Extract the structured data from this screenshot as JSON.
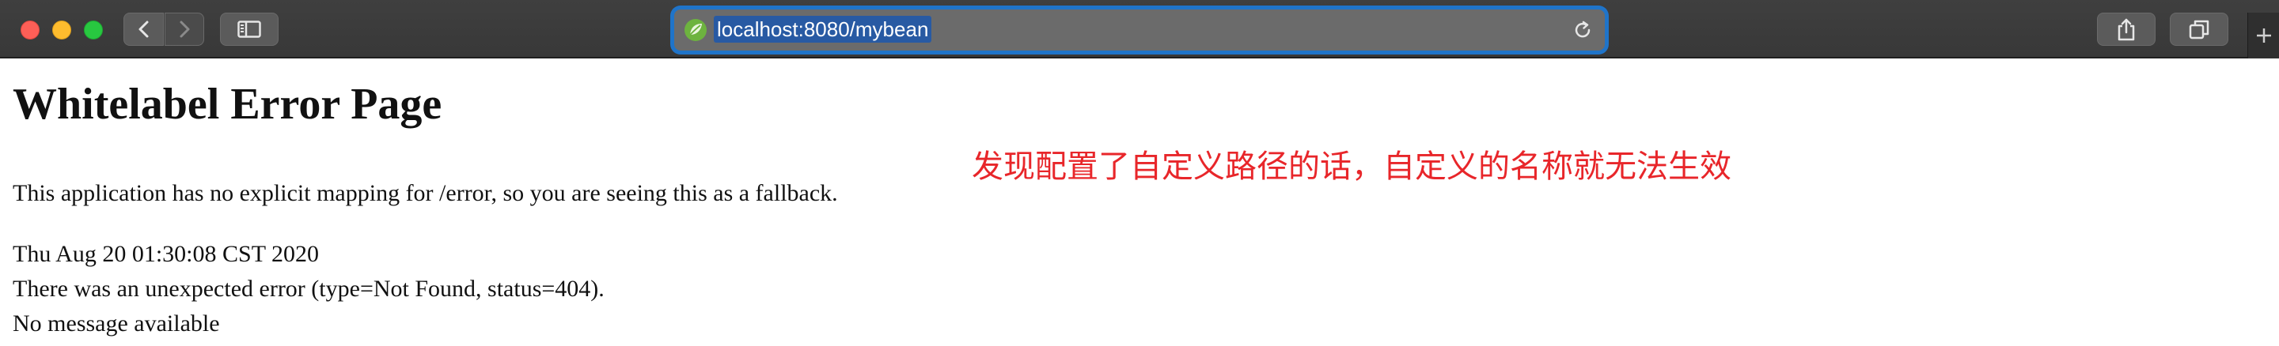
{
  "browser": {
    "url": "localhost:8080/mybean",
    "favicon": "spring-leaf-icon",
    "toolbar_icons": [
      "back-chevron-icon",
      "forward-chevron-icon",
      "sidebar-icon",
      "reload-icon",
      "share-icon",
      "tabs-icon",
      "plus-icon"
    ]
  },
  "page": {
    "title": "Whitelabel Error Page",
    "description": "This application has no explicit mapping for /error, so you are seeing this as a fallback.",
    "timestamp": "Thu Aug 20 01:30:08 CST 2020",
    "error_line": "There was an unexpected error (type=Not Found, status=404).",
    "message": "No message available"
  },
  "annotation": {
    "text": "发现配置了自定义路径的话，自定义的名称就无法生效",
    "color": "#e8262a"
  },
  "colors": {
    "toolbar": "#3c3c3c",
    "address_focus": "#1f74c9",
    "url_highlight": "#285aa3"
  }
}
